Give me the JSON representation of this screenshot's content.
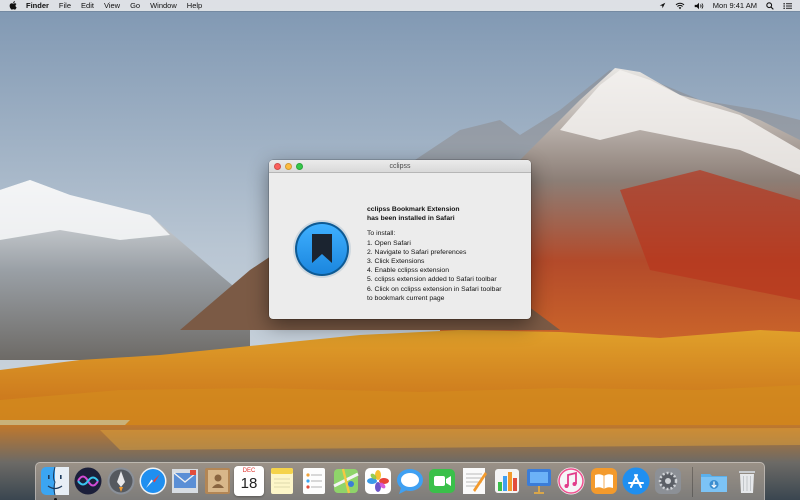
{
  "menubar": {
    "app_name": "Finder",
    "menus": [
      "File",
      "Edit",
      "View",
      "Go",
      "Window",
      "Help"
    ],
    "clock": "Mon 9:41 AM",
    "status_icons": [
      "location-icon",
      "wifi-icon",
      "volume-icon",
      "spotlight-icon",
      "control-list-icon"
    ]
  },
  "window": {
    "title": "cclipss",
    "heading": "cclipss Bookmark Extension\n has been installed in Safari",
    "instructions": [
      "To install:",
      "1. Open Safari",
      "2. Navigate to Safari preferences",
      "3. Click Extensions",
      "4. Enable cclipss extension",
      "5. cclipss extension added to Safari toolbar",
      "6. Click on cclipss extension in Safari toolbar",
      "to bookmark current page"
    ]
  },
  "dock": {
    "calendar_month": "DEC",
    "calendar_day": "18",
    "apps": [
      "finder",
      "siri",
      "launchpad",
      "safari",
      "mail",
      "contacts",
      "calendar",
      "notes",
      "reminders",
      "maps",
      "photos",
      "messages",
      "facetime",
      "pages",
      "numbers",
      "keynote",
      "itunes",
      "ibooks",
      "app-store",
      "system-preferences",
      "downloads",
      "trash"
    ]
  },
  "colors": {
    "app_icon_blue": "#2b9cf0",
    "app_icon_ring": "#0d5a94"
  }
}
